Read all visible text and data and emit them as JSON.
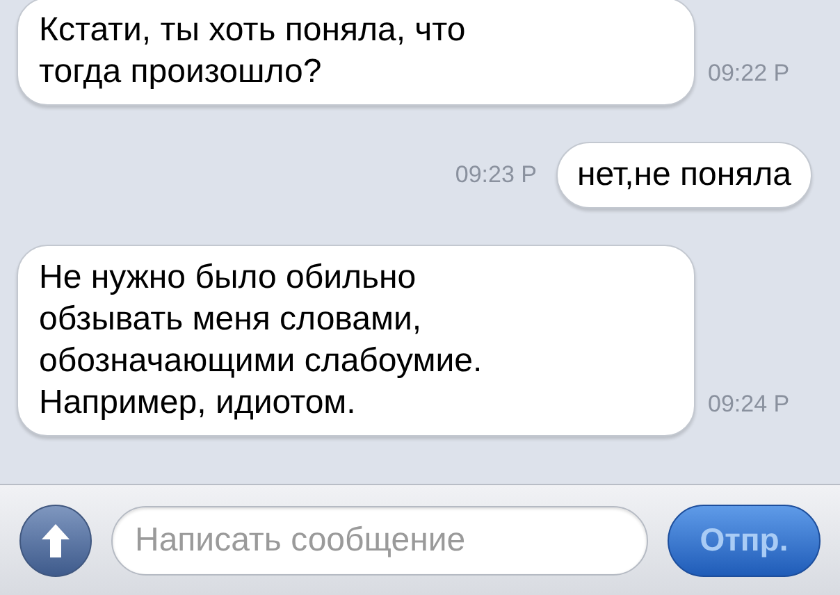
{
  "messages": [
    {
      "kind": "incoming",
      "text": "Кстати, ты хоть поняла, что тогда произошло?",
      "time": "09:22 P"
    },
    {
      "kind": "outgoing",
      "text": "нет,не поняла",
      "time": "09:23 P"
    },
    {
      "kind": "incoming",
      "text": "Не нужно было обильно обзывать меня словами, обозначающими слабоумие. Например, идиотом.",
      "time": "09:24 P"
    }
  ],
  "composer": {
    "placeholder": "Написать сообщение",
    "send_button": "Отпр."
  }
}
